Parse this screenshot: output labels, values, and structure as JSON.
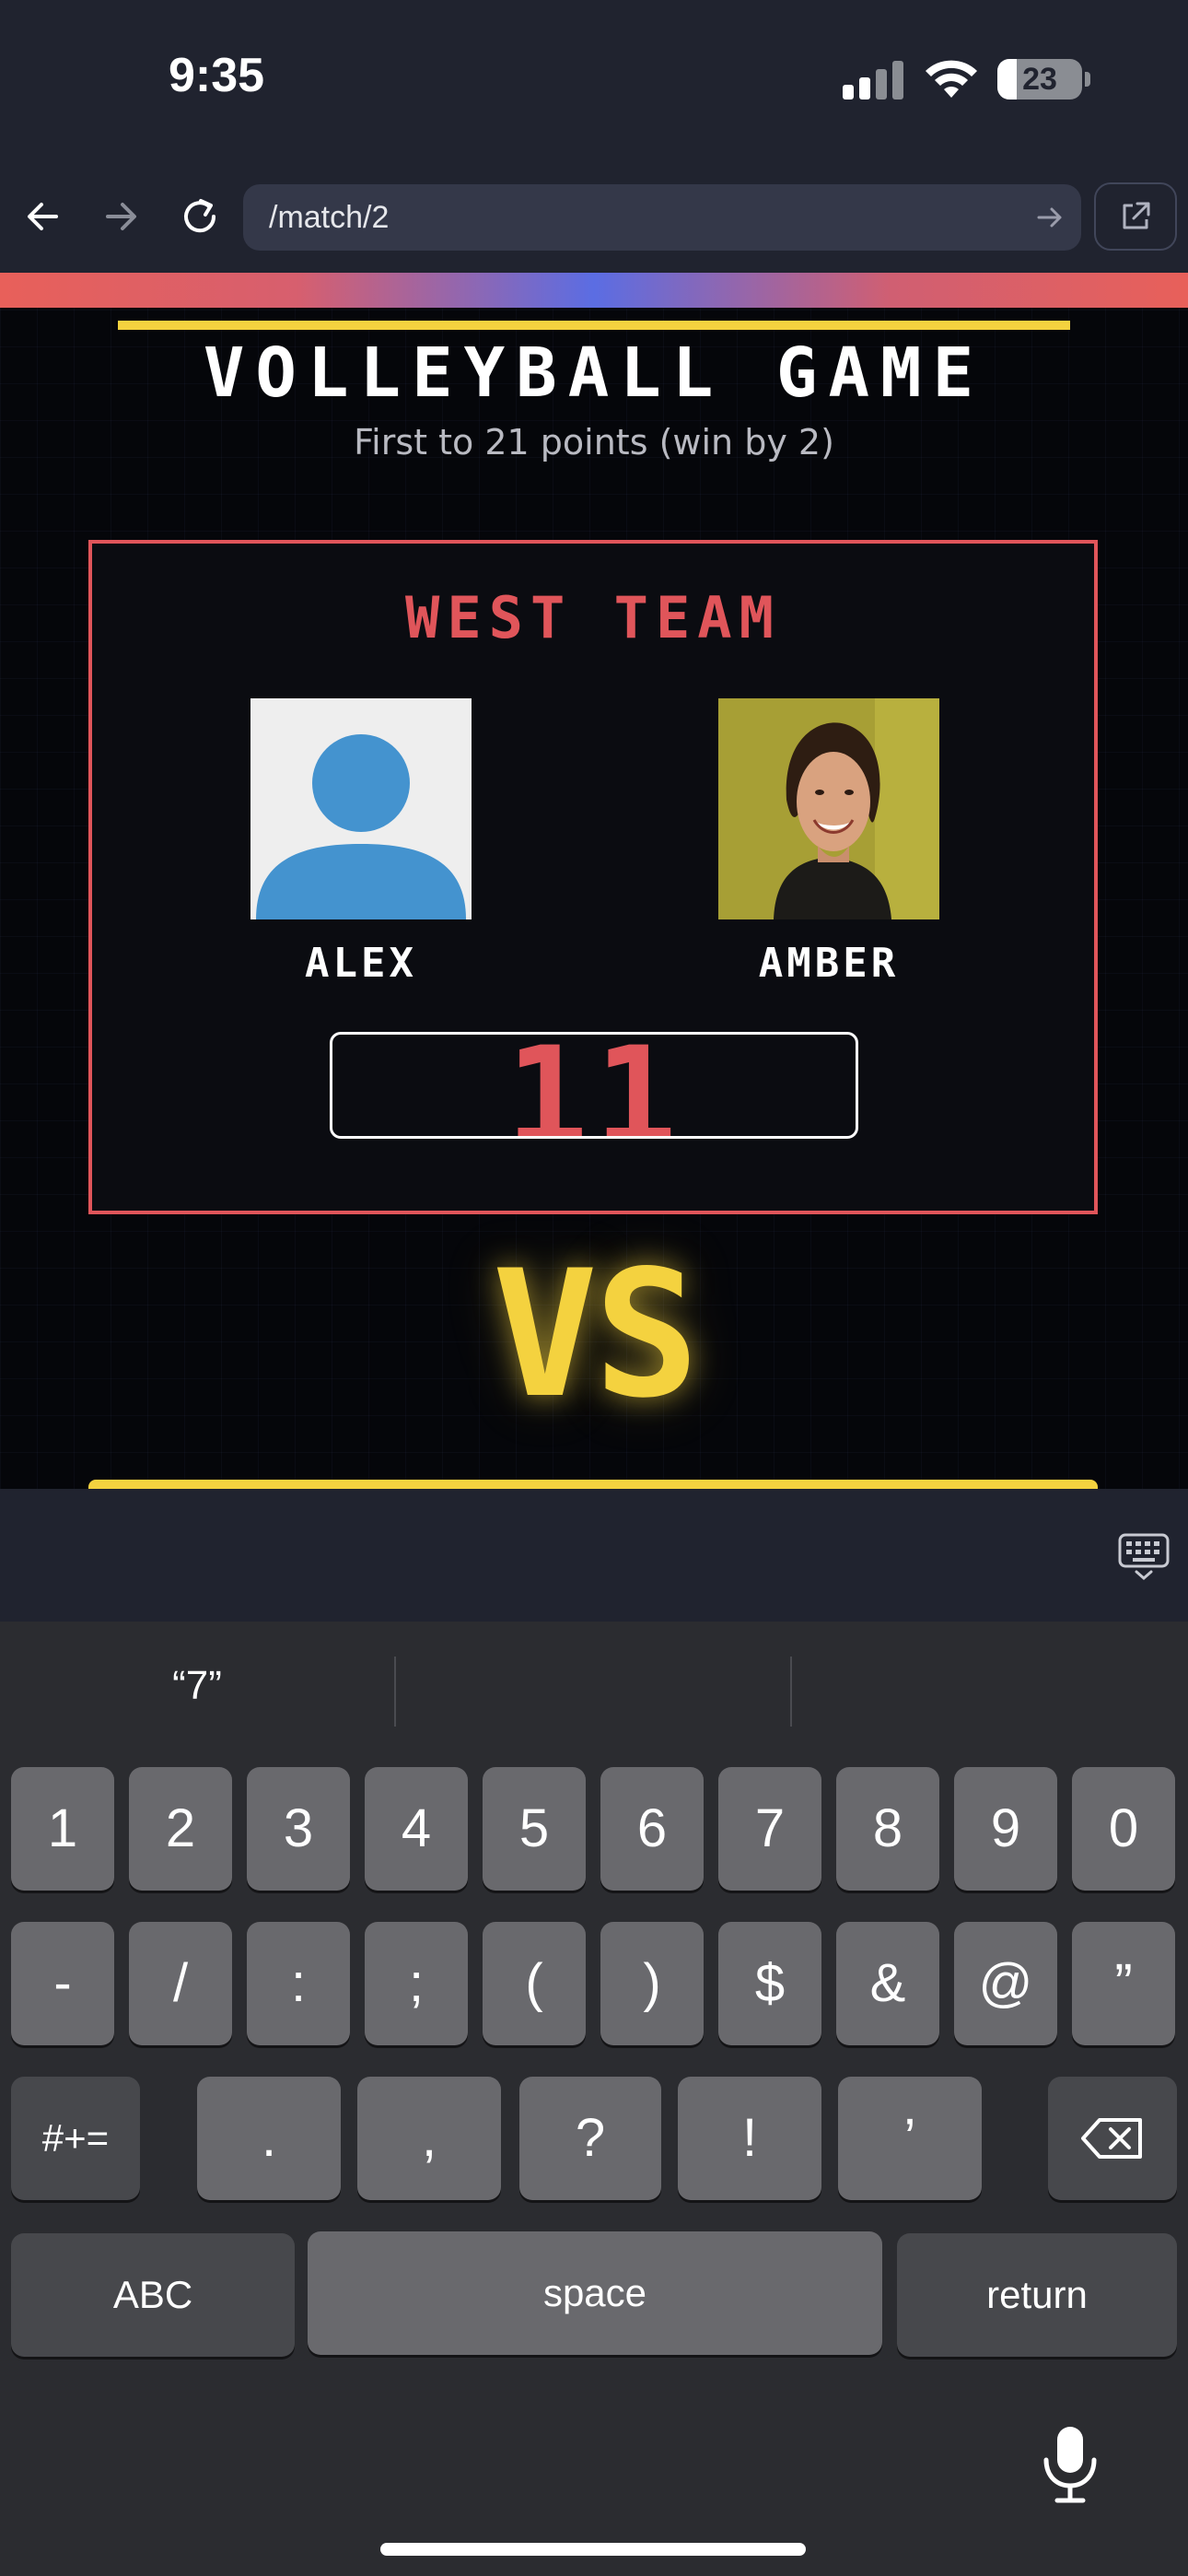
{
  "status_bar": {
    "time": "9:35",
    "battery_percent": "23",
    "battery_level": 0.23
  },
  "browser": {
    "url": "/match/2",
    "back_icon": "arrow-left-icon",
    "forward_icon": "arrow-right-icon",
    "reload_icon": "reload-icon",
    "share_icon": "open-external-icon"
  },
  "page": {
    "title": "VOLLEYBALL GAME",
    "subtitle": "First to 21 points (win by 2)",
    "team": {
      "name": "WEST TEAM",
      "players": [
        {
          "name": "ALEX",
          "avatar": "default-avatar"
        },
        {
          "name": "AMBER",
          "avatar": "photo"
        }
      ],
      "score_input_value": "11"
    },
    "vs_label": "VS"
  },
  "keyboard": {
    "suggestions": [
      "“7”",
      "",
      ""
    ],
    "row1": [
      "1",
      "2",
      "3",
      "4",
      "5",
      "6",
      "7",
      "8",
      "9",
      "0"
    ],
    "row2": [
      "-",
      "/",
      ":",
      ";",
      "(",
      ")",
      "$",
      "&",
      "@",
      "”"
    ],
    "row3": [
      ".",
      ",",
      "?",
      "!",
      "’"
    ],
    "shift_label": "#+=",
    "abc_label": "ABC",
    "space_label": "space",
    "return_label": "return"
  },
  "colors": {
    "accent_red": "#e0555a",
    "accent_yellow": "#f4d23f",
    "background": "#05060a"
  }
}
